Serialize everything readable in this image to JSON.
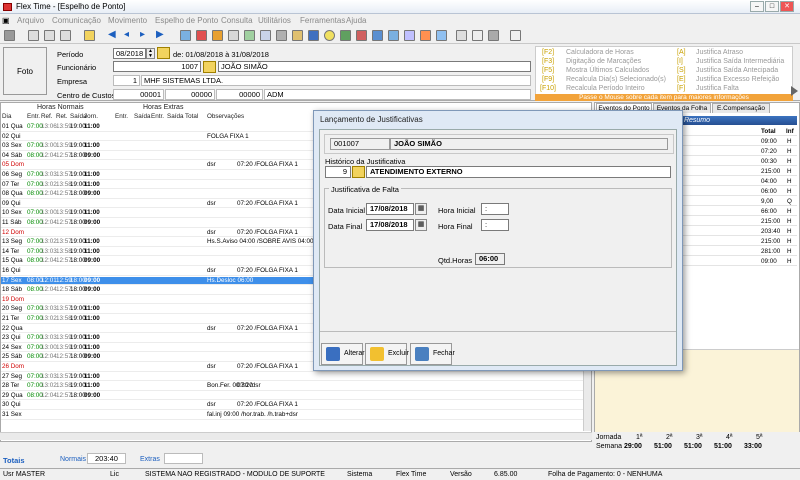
{
  "window": {
    "title": "Flex Time - [Espelho de Ponto]"
  },
  "menu": [
    "Arquivo",
    "Comunicação",
    "Movimento",
    "Espelho de Ponto",
    "Consulta",
    "Utilitários",
    "Ferramentas",
    "Ajuda"
  ],
  "header": {
    "foto_label": "Foto",
    "periodo_label": "Período",
    "periodo_value": "08/2018",
    "periodo_range": "de: 01/08/2018 à 31/08/2018",
    "funcionario_label": "Funcionário",
    "funcionario_code": "1007",
    "funcionario_name": "JOÃO SIMÃO",
    "empresa_label": "Empresa",
    "empresa_code": "1",
    "empresa_name": "MHF SISTEMAS LTDA.",
    "centro_label": "Centro de Custos",
    "centro_1": "00001",
    "centro_2": "00000",
    "centro_3": "00000",
    "centro_name": "ADM"
  },
  "shortcuts": [
    {
      "key": "[F2]",
      "label": "Calculadora de Horas"
    },
    {
      "key": "[F3]",
      "label": "Digitação de Marcações"
    },
    {
      "key": "[F5]",
      "label": "Mostra Últimos Calculados"
    },
    {
      "key": "[F9]",
      "label": "Recalcula Dia(s) Selecionado(s)"
    },
    {
      "key": "[F10]",
      "label": "Recalcula Período Inteiro"
    },
    {
      "key": "[A]",
      "label": "Justifica Atraso"
    },
    {
      "key": "[I]",
      "label": "Justifica Saída Intermediária"
    },
    {
      "key": "[S]",
      "label": "Justifica Saída Antecipada"
    },
    {
      "key": "[E]",
      "label": "Justifica Excesso Refeição"
    },
    {
      "key": "[F]",
      "label": "Justifica Falta"
    }
  ],
  "hover_hint": "Passe o Mouse sobre cada item para maiores informações",
  "grid": {
    "group_normais": "Horas Normais",
    "group_extras": "Horas Extras",
    "columns": [
      "Dia",
      "Entr.",
      "Ref.",
      "Ret.",
      "Saída",
      "Jorn.",
      "Entr.",
      "Saída",
      "Entr.",
      "Saída",
      "Total",
      "Observações"
    ],
    "rows": [
      {
        "dia": "01 Qua",
        "e": "07:00",
        "r": "13:06",
        "t": "13:59",
        "s": "19:00",
        "j": "11:00",
        "obs": "",
        "obs2": "",
        "type": "n"
      },
      {
        "dia": "02 Qui",
        "e": "",
        "r": "",
        "t": "",
        "s": "",
        "j": "",
        "obs": "FOLGA FIXA 1",
        "obs2": "",
        "type": "n"
      },
      {
        "dia": "03 Sex",
        "e": "07:00",
        "r": "13:00",
        "t": "13:59",
        "s": "19:00",
        "j": "11:00",
        "obs": "",
        "obs2": "",
        "type": "n"
      },
      {
        "dia": "04 Sáb",
        "e": "08:00",
        "r": "12:04",
        "t": "12:57",
        "s": "18:00",
        "j": "09:00",
        "obs": "",
        "obs2": "",
        "type": "n"
      },
      {
        "dia": "05 Dom",
        "e": "",
        "r": "",
        "t": "",
        "s": "",
        "j": "",
        "obs": "dsr",
        "obs2": "07:20 /FOLGA FIXA 1",
        "type": "dom"
      },
      {
        "dia": "06 Seg",
        "e": "07:00",
        "r": "13:03",
        "t": "13:57",
        "s": "19:00",
        "j": "11:00",
        "obs": "",
        "obs2": "",
        "type": "n"
      },
      {
        "dia": "07 Ter",
        "e": "07:00",
        "r": "13:02",
        "t": "13:58",
        "s": "19:00",
        "j": "11:00",
        "obs": "",
        "obs2": "",
        "type": "n"
      },
      {
        "dia": "08 Qua",
        "e": "08:00",
        "r": "12:04",
        "t": "12:57",
        "s": "18:00",
        "j": "09:00",
        "obs": "",
        "obs2": "",
        "type": "n"
      },
      {
        "dia": "09 Qui",
        "e": "",
        "r": "",
        "t": "",
        "s": "",
        "j": "",
        "obs": "dsr",
        "obs2": "07:20 /FOLGA FIXA 1",
        "type": "n"
      },
      {
        "dia": "10 Sex",
        "e": "07:00",
        "r": "13:00",
        "t": "13:59",
        "s": "19:00",
        "j": "11:00",
        "obs": "",
        "obs2": "",
        "type": "n"
      },
      {
        "dia": "11 Sáb",
        "e": "08:00",
        "r": "12:04",
        "t": "12:57",
        "s": "18:00",
        "j": "09:00",
        "obs": "",
        "obs2": "",
        "type": "n"
      },
      {
        "dia": "12 Dom",
        "e": "",
        "r": "",
        "t": "",
        "s": "",
        "j": "",
        "obs": "dsr",
        "obs2": "07:20 /FOLGA FIXA 1",
        "type": "dom"
      },
      {
        "dia": "13 Seg",
        "e": "07:00",
        "r": "13:02",
        "t": "13:57",
        "s": "19:00",
        "j": "11:00",
        "obs": "Hs.S.Aviso 04:00 /SOBRE AVIS 04:00",
        "obs2": "",
        "type": "n"
      },
      {
        "dia": "14 Ter",
        "e": "07:00",
        "r": "13:03",
        "t": "13:58",
        "s": "19:00",
        "j": "11:00",
        "obs": "",
        "obs2": "",
        "type": "n"
      },
      {
        "dia": "15 Qua",
        "e": "08:00",
        "r": "12:04",
        "t": "12:57",
        "s": "18:00",
        "j": "09:00",
        "obs": "",
        "obs2": "",
        "type": "n"
      },
      {
        "dia": "16 Qui",
        "e": "",
        "r": "",
        "t": "",
        "s": "",
        "j": "",
        "obs": "dsr",
        "obs2": "07:20 /FOLGA FIXA 1",
        "type": "n"
      },
      {
        "dia": "17 Sex",
        "e": "08:00",
        "r": "12:01",
        "t": "12:59",
        "s": "18:00",
        "j": "09:00",
        "obs": "Hs.Desloc 06:00",
        "obs2": "",
        "type": "sel"
      },
      {
        "dia": "18 Sáb",
        "e": "08:00",
        "r": "12:04",
        "t": "12:57",
        "s": "18:00",
        "j": "09:00",
        "obs": "",
        "obs2": "",
        "type": "n"
      },
      {
        "dia": "19 Dom",
        "e": "",
        "r": "",
        "t": "",
        "s": "",
        "j": "",
        "obs": "",
        "obs2": "",
        "type": "dom"
      },
      {
        "dia": "20 Seg",
        "e": "07:00",
        "r": "13:03",
        "t": "13:57",
        "s": "19:00",
        "j": "11:00",
        "obs": "",
        "obs2": "",
        "type": "n"
      },
      {
        "dia": "21 Ter",
        "e": "07:00",
        "r": "13:02",
        "t": "13:58",
        "s": "19:00",
        "j": "11:00",
        "obs": "",
        "obs2": "",
        "type": "n"
      },
      {
        "dia": "22 Qua",
        "e": "",
        "r": "",
        "t": "",
        "s": "",
        "j": "",
        "obs": "dsr",
        "obs2": "07:20 /FOLGA FIXA 1",
        "type": "n"
      },
      {
        "dia": "23 Qui",
        "e": "07:00",
        "r": "13:03",
        "t": "13:59",
        "s": "19:00",
        "j": "11:00",
        "obs": "",
        "obs2": "",
        "type": "n"
      },
      {
        "dia": "24 Sex",
        "e": "07:00",
        "r": "13:00",
        "t": "13:59",
        "s": "19:00",
        "j": "11:00",
        "obs": "",
        "obs2": "",
        "type": "n"
      },
      {
        "dia": "25 Sáb",
        "e": "08:00",
        "r": "12:04",
        "t": "12:57",
        "s": "18:00",
        "j": "09:00",
        "obs": "",
        "obs2": "",
        "type": "n"
      },
      {
        "dia": "26 Dom",
        "e": "",
        "r": "",
        "t": "",
        "s": "",
        "j": "",
        "obs": "dsr",
        "obs2": "07:20 /FOLGA FIXA 1",
        "type": "dom"
      },
      {
        "dia": "27 Seg",
        "e": "07:00",
        "r": "13:03",
        "t": "13:57",
        "s": "19:00",
        "j": "11:00",
        "obs": "",
        "obs2": "",
        "type": "n"
      },
      {
        "dia": "28 Ter",
        "e": "07:00",
        "r": "13:02",
        "t": "13:58",
        "s": "19:00",
        "j": "11:00",
        "obs": "Bon.Fer. 00:30 /dsr",
        "obs2": "07:20",
        "type": "n"
      },
      {
        "dia": "29 Qua",
        "e": "08:00",
        "r": "12:04",
        "t": "12:57",
        "s": "18:00",
        "j": "09:00",
        "obs": "",
        "obs2": "",
        "type": "n"
      },
      {
        "dia": "30 Qui",
        "e": "",
        "r": "",
        "t": "",
        "s": "",
        "j": "",
        "obs": "dsr",
        "obs2": "07:20 /FOLGA FIXA 1",
        "type": "n"
      },
      {
        "dia": "31 Sex",
        "e": "",
        "r": "",
        "t": "",
        "s": "",
        "j": "",
        "obs": "fal.inj 09:00 /hor.trab. /h.trab+dsr",
        "obs2": "",
        "type": "n"
      }
    ]
  },
  "totais": {
    "label": "Totais",
    "normais_label": "Normais",
    "normais_value": "203:40",
    "extras_label": "Extras"
  },
  "right_panel": {
    "tabs": [
      "Eventos do Ponto",
      "Eventos da Folha",
      "E.Compensação"
    ],
    "resumo_title": "Resumo",
    "col_total": "Total",
    "col_inf": "Inf",
    "rows": [
      {
        "desc": "ada",
        "total": "09:00",
        "inf": "H"
      },
      {
        "desc": "em Horas",
        "total": "07:20",
        "inf": "H"
      },
      {
        "desc": "Jornada no Feriado",
        "total": "00:30",
        "inf": "H"
      },
      {
        "desc": "",
        "total": "215:00",
        "inf": "H"
      },
      {
        "desc": "viso",
        "total": "04:00",
        "inf": "H"
      },
      {
        "desc": "mento",
        "total": "06:00",
        "inf": "H"
      },
      {
        "desc": "",
        "total": "9,00",
        "inf": "Q"
      },
      {
        "desc": "ranal Remunerado",
        "total": "66:00",
        "inf": "H"
      },
      {
        "desc": "Normais no Dia",
        "total": "215:00",
        "inf": "H"
      },
      {
        "desc": "Normais no Mês",
        "total": "203:40",
        "inf": "H"
      },
      {
        "desc": "adas",
        "total": "215:00",
        "inf": "H"
      },
      {
        "desc": "adas+DSR",
        "total": "281:00",
        "inf": "H"
      },
      {
        "desc": "",
        "total": "09:00",
        "inf": "H"
      }
    ],
    "jornada_label": "Jornada",
    "weeks": [
      "1ª",
      "2ª",
      "3ª",
      "4ª",
      "5ª"
    ],
    "semana_label": "Semana",
    "semana_values": [
      "29:00",
      "51:00",
      "51:00",
      "51:00",
      "33:00"
    ]
  },
  "statusbar": {
    "user": "Usr MASTER",
    "lic": "Lic",
    "license_text": "SISTEMA NAO REGISTRADO - MODULO DE SUPORTE",
    "sistema_label": "Sistema",
    "sistema_name": "Flex Time",
    "versao_label": "Versão",
    "versao": "6.85.00",
    "folha": "Folha de Pagamento: 0 - NENHUMA"
  },
  "dialog": {
    "title": "Lançamento de Justificativas",
    "emp_code": "001007",
    "emp_name": "JOÃO SIMÃO",
    "historico_label": "Histórico da Justificativa",
    "historico_code": "9",
    "historico_name": "ATENDIMENTO EXTERNO",
    "group_label": "Justificativa de Falta",
    "data_inicial_label": "Data Inicial",
    "data_inicial": "17/08/2018",
    "data_final_label": "Data Final",
    "data_final": "17/08/2018",
    "hora_inicial_label": "Hora Inicial",
    "hora_inicial": ":",
    "hora_final_label": "Hora Final",
    "hora_final": ":",
    "qtd_label": "Qtd.Horas",
    "qtd_value": "06:00",
    "btn_alterar": "Alterar",
    "btn_excluir": "Excluir",
    "btn_fechar": "Fechar"
  },
  "colors": {
    "selected_row": "#3e8fea",
    "sunday": "#d00000",
    "entry_green": "#008a00",
    "accent": "#f2a33a"
  }
}
